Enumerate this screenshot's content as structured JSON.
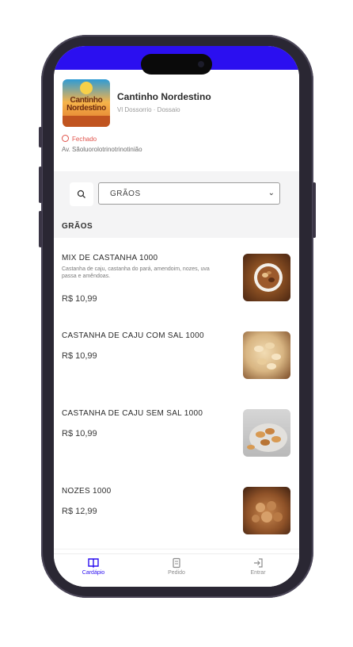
{
  "store": {
    "logo_text": "Cantinho Nordestino",
    "name": "Cantinho Nordestino",
    "subtitle": "Vl Dossorrio · Dossaio",
    "status": "Fechado",
    "address": "Av. Sãoluorolotrinotrinotinião"
  },
  "filter": {
    "selected_category": "GRÃOS"
  },
  "section": {
    "title": "GRÃOS"
  },
  "products": [
    {
      "name": "MIX DE CASTANHA 1000",
      "description": "Castanha de caju, castanha do pará, amendoim, nozes, uva passa e amêndoas.",
      "price": "R$ 10,99"
    },
    {
      "name": "CASTANHA DE CAJU COM SAL 1000",
      "description": "",
      "price": "R$ 10,99"
    },
    {
      "name": "CASTANHA DE CAJU SEM SAL 1000",
      "description": "",
      "price": "R$ 10,99"
    },
    {
      "name": "NOZES 1000",
      "description": "",
      "price": "R$ 12,99"
    }
  ],
  "nav": {
    "items": [
      {
        "label": "Cardápio",
        "icon": "book-icon",
        "active": true
      },
      {
        "label": "Pedido",
        "icon": "receipt-icon",
        "active": false
      },
      {
        "label": "Entrar",
        "icon": "login-icon",
        "active": false
      }
    ]
  },
  "colors": {
    "brand": "#2b0ff0",
    "closed": "#e0524a"
  }
}
